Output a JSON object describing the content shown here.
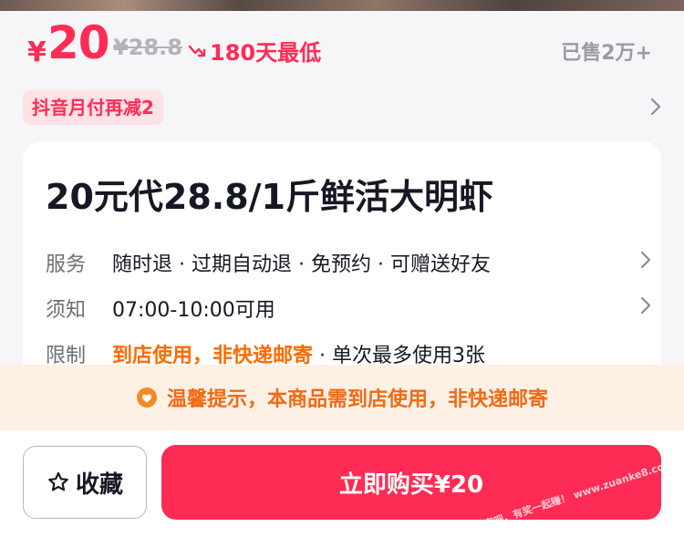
{
  "price": {
    "currency": "¥",
    "current": "20",
    "original": "¥28.8",
    "lowest_label": "180天最低",
    "sold": "已售2万+"
  },
  "promo": {
    "tag": "抖音月付再减2"
  },
  "product": {
    "title": "20元代28.8/1斤鲜活大明虾",
    "service": {
      "label": "服务",
      "value": "随时退 · 过期自动退 · 免预约 · 可赠送好友"
    },
    "notice": {
      "label": "须知",
      "value": "07:00-10:00可用"
    },
    "limit": {
      "label": "限制",
      "highlight": "到店使用，非快递邮寄",
      "rest": " · 单次最多使用3张"
    }
  },
  "tip": {
    "text": "温馨提示，本商品需到店使用，非快递邮寄"
  },
  "actions": {
    "favorite_label": "收藏",
    "buy_label": "立即购买¥20"
  },
  "watermark": "赚客吧，有奖一起赚！ www.zuanke8.com",
  "colors": {
    "accent": "#fe2c55",
    "warning": "#f06a16",
    "tip_bg": "#fdf1e6"
  }
}
